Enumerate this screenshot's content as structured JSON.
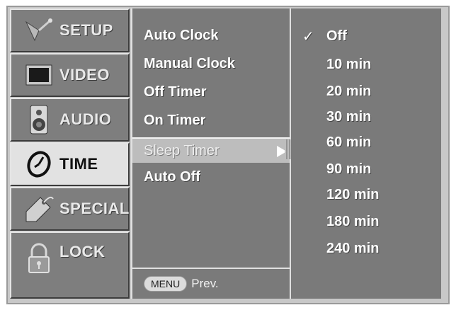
{
  "categories": [
    {
      "label": "SETUP",
      "icon": "satellite-icon"
    },
    {
      "label": "VIDEO",
      "icon": "tv-icon"
    },
    {
      "label": "AUDIO",
      "icon": "speaker-icon"
    },
    {
      "label": "TIME",
      "icon": "clock-icon",
      "active": true
    },
    {
      "label": "SPECIAL",
      "icon": "tag-icon"
    },
    {
      "label": "LOCK",
      "icon": "lock-icon"
    }
  ],
  "submenu": {
    "items": [
      "Auto Clock",
      "Manual Clock",
      "Off Timer",
      "On Timer",
      "Sleep Timer",
      "Auto Off"
    ],
    "selected_index": 4,
    "footer_key": "MENU",
    "footer_label": "Prev."
  },
  "options": {
    "items": [
      "Off",
      "10 min",
      "20 min",
      "30 min",
      "60 min",
      "90 min",
      "120 min",
      "180 min",
      "240 min"
    ],
    "checked_index": 0,
    "check_mark": "✓"
  },
  "colors": {
    "panel": "#7a7a7a",
    "active_tab": "#e2e2e2",
    "highlight": "#bdbdbd"
  }
}
